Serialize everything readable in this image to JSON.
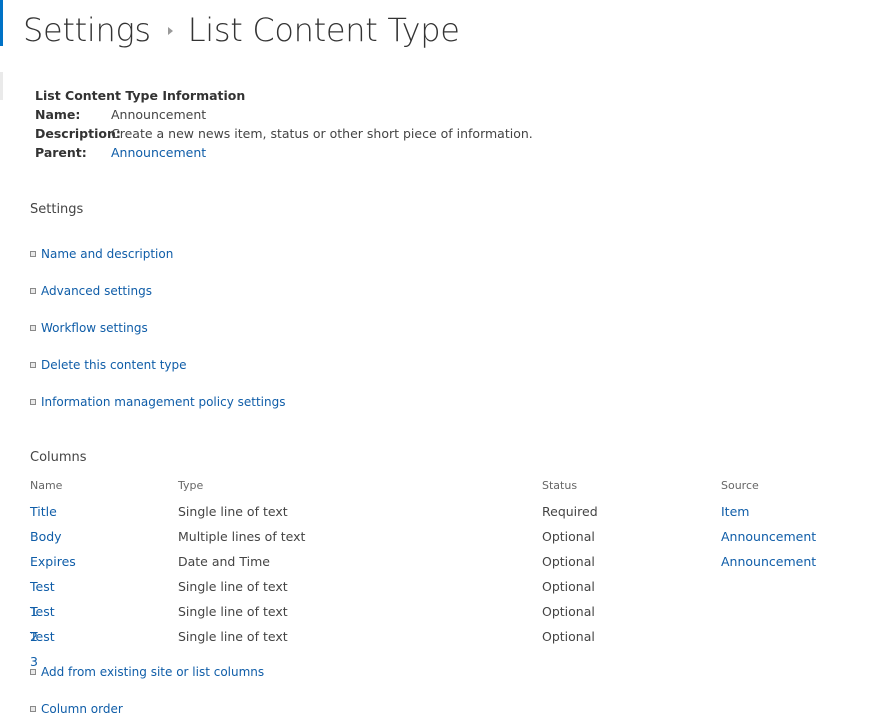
{
  "header": {
    "breadcrumb_root": "Settings",
    "page_title": "List Content Type"
  },
  "info": {
    "heading": "List Content Type Information",
    "name_label": "Name:",
    "name_value": "Announcement",
    "description_label": "Description:",
    "description_value": "Create a new news item, status or other short piece of information.",
    "parent_label": "Parent:",
    "parent_value": "Announcement"
  },
  "settings": {
    "heading": "Settings",
    "links": [
      "Name and description",
      "Advanced settings",
      "Workflow settings",
      "Delete this content type",
      "Information management policy settings"
    ]
  },
  "columns": {
    "heading": "Columns",
    "headers": [
      "Name",
      "Type",
      "Status",
      "Source"
    ],
    "rows": [
      {
        "name": "Title",
        "type": "Single line of text",
        "status": "Required",
        "source": "Item"
      },
      {
        "name": "Body",
        "type": "Multiple lines of text",
        "status": "Optional",
        "source": "Announcement"
      },
      {
        "name": "Expires",
        "type": "Date and Time",
        "status": "Optional",
        "source": "Announcement"
      },
      {
        "name": "Test 1",
        "type": "Single line of text",
        "status": "Optional",
        "source": ""
      },
      {
        "name": "Test 2",
        "type": "Single line of text",
        "status": "Optional",
        "source": ""
      },
      {
        "name": "Test 3",
        "type": "Single line of text",
        "status": "Optional",
        "source": ""
      }
    ],
    "links": [
      "Add from existing site or list columns",
      "Column order"
    ]
  },
  "colors": {
    "accent": "#0072c6",
    "link": "#0f5da8",
    "text": "#444444"
  },
  "icons": {
    "breadcrumb_separator": "chevron-right-icon",
    "list_bullet": "square-bullet-icon"
  }
}
